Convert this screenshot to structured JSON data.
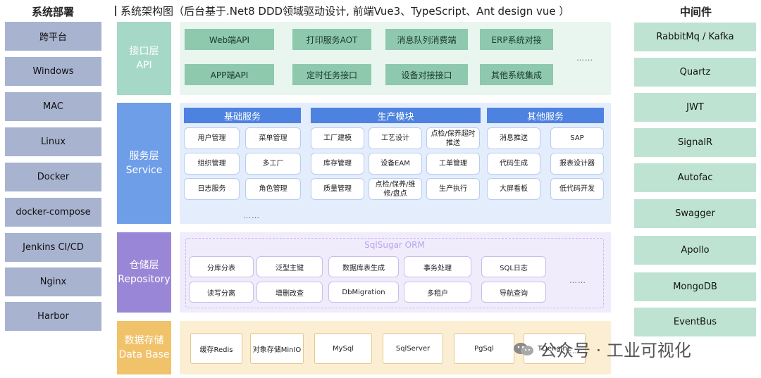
{
  "deploy_header": "系统部署",
  "middleware_header": "中间件",
  "title": "系统架构图（后台基于.Net8 DDD领域驱动设计, 前端Vue3、TypeScript、Ant design  vue ）",
  "deploy_items": [
    "跨平台",
    "Windows",
    "MAC",
    "Linux",
    "Docker",
    "docker-compose",
    "Jenkins CI/CD",
    "Nginx",
    "Harbor"
  ],
  "middleware_items": [
    "RabbitMq / Kafka",
    "Quartz",
    "JWT",
    "SignalR",
    "Autofac",
    "Swagger",
    "Apollo",
    "MongoDB",
    "EventBus"
  ],
  "api_layer": {
    "label_cn": "接口层",
    "label_en": "API",
    "items": [
      "Web端API",
      "打印服务AOT",
      "消息队列消费端",
      "ERP系统对接",
      "APP端API",
      "定时任务接口",
      "设备对接接口",
      "其他系统集成"
    ],
    "ellipsis": "……"
  },
  "service_layer": {
    "label_cn": "服务层",
    "label_en": "Service",
    "sections": [
      {
        "title": "基础服务",
        "items": [
          "用户管理",
          "菜单管理",
          "组织管理",
          "多工厂",
          "日志服务",
          "角色管理"
        ]
      },
      {
        "title": "生产模块",
        "items": [
          "工厂建模",
          "工艺设计",
          "点检/保养超时推送",
          "库存管理",
          "设备EAM",
          "工单管理",
          "质量管理",
          "点检/保养/维修/盘点",
          "生产执行"
        ]
      },
      {
        "title": "其他服务",
        "items": [
          "消息推送",
          "SAP",
          "代码生成",
          "报表设计器",
          "大屏看板",
          "低代码开发"
        ]
      }
    ],
    "ellipsis": "……"
  },
  "repository_layer": {
    "label_cn": "仓储层",
    "label_en": "Repository",
    "orm_title": "SqlSugar ORM",
    "items": [
      "分库分表",
      "泛型主键",
      "数据库表生成",
      "事务处理",
      "SQL日志",
      "读写分离",
      "增删改查",
      "DbMigration",
      "多租户",
      "导航查询"
    ],
    "ellipsis": "……"
  },
  "database_layer": {
    "label_cn": "数据存储",
    "label_en": "Data Base",
    "items": [
      "缓存Redis",
      "对象存储MinIO",
      "MySql",
      "SqlServer",
      "PgSql",
      "TDengine"
    ],
    "ellipsis": "……"
  },
  "watermark": "公众号 · 工业可视化",
  "colors": {
    "deploy": "#a7b3cf",
    "middleware": "#bfe3d2",
    "api_label": "#a6d8c8",
    "service_label": "#6f9ee9",
    "repository_label": "#9a86d6",
    "database_label": "#f0c26a"
  }
}
